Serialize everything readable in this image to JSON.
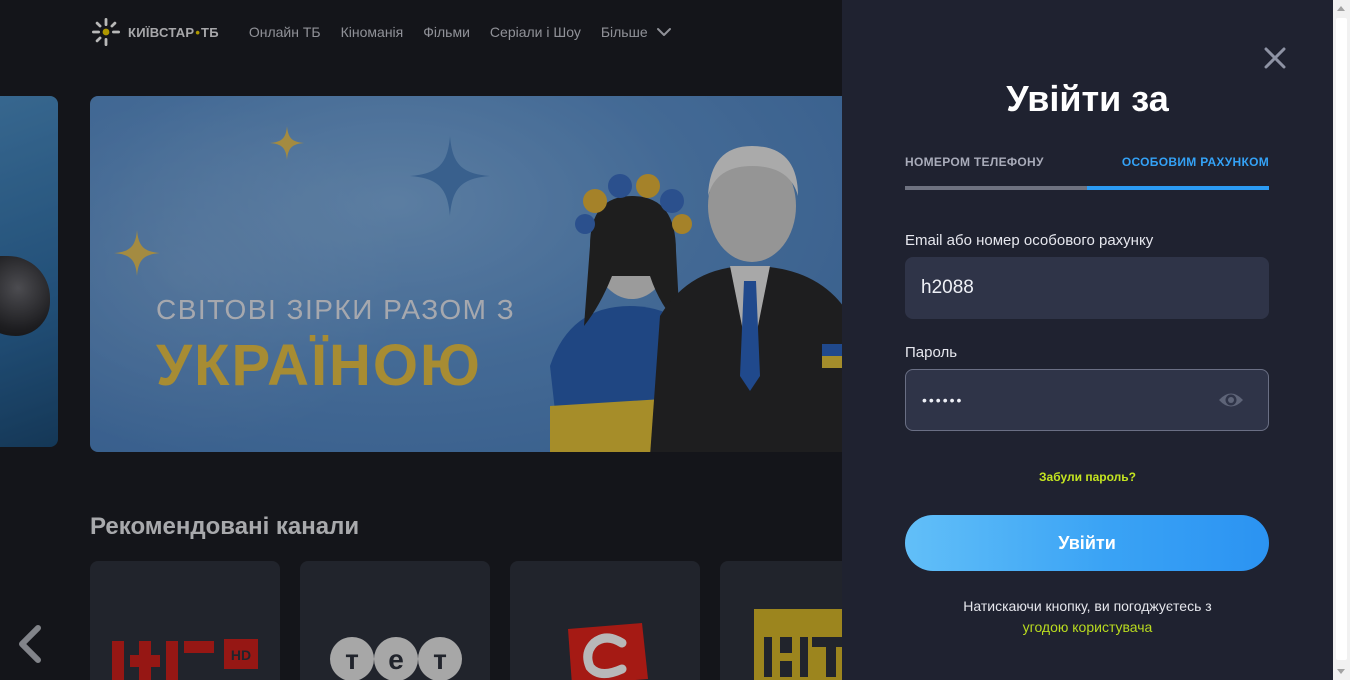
{
  "header": {
    "logo_text": "КИЇВСТАР",
    "logo_dot": "•",
    "logo_suffix": "ТБ",
    "nav": [
      {
        "label": "Онлайн ТБ"
      },
      {
        "label": "Кіноманія"
      },
      {
        "label": "Фільми"
      },
      {
        "label": "Серіали і Шоу"
      },
      {
        "label": "Більше"
      }
    ]
  },
  "banner": {
    "subtitle": "СВІТОВІ ЗІРКИ РАЗОМ З",
    "title": "УКРАЇНОЮ"
  },
  "recommended": {
    "title": "Рекомендовані канали",
    "channels": [
      {
        "name": "1+1 HD",
        "logo": "1+1",
        "badge": "HD"
      },
      {
        "name": "ТЕТ",
        "logo": "тет"
      },
      {
        "name": "СТБ",
        "logo": "С"
      },
      {
        "name": "НТН",
        "logo": "НТ"
      }
    ]
  },
  "login": {
    "title": "Увійти за",
    "tabs": [
      {
        "label": "НОМЕРОМ ТЕЛЕФОНУ",
        "active": false
      },
      {
        "label": "ОСОБОВИМ РАХУНКОМ",
        "active": true
      }
    ],
    "email_label": "Email або номер особового рахунку",
    "email_value": "h2088",
    "password_label": "Пароль",
    "password_value": "••••••",
    "forgot": "Забули пароль?",
    "submit": "Увійти",
    "agree_text": "Натискаючи кнопку, ви погоджуєтесь з",
    "agree_link": "угодою користувача"
  },
  "colors": {
    "accent_blue": "#2b9bf3",
    "link_green": "#b9db1f",
    "panel_bg": "#1f2230",
    "page_bg": "#1c1e24"
  },
  "icons": {
    "close": "close-icon",
    "eye": "eye-icon",
    "chevron": "chevron-down-icon",
    "prev": "chevron-left-icon"
  }
}
